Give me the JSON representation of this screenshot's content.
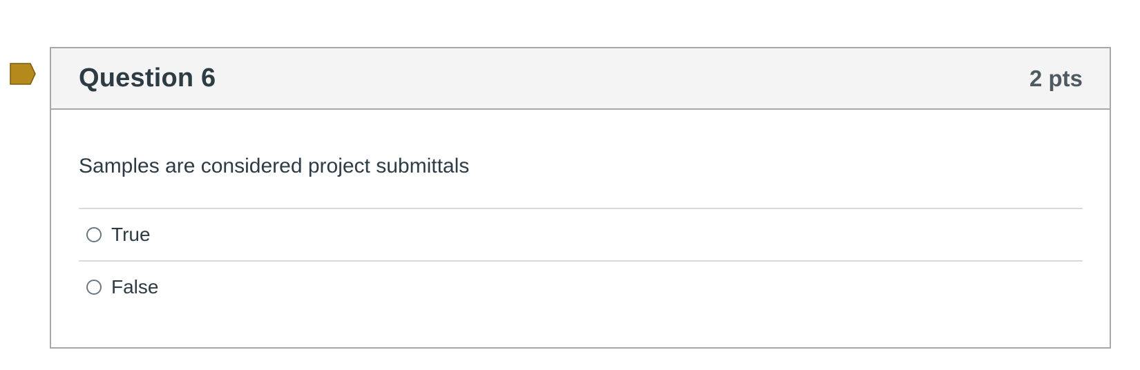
{
  "question": {
    "title": "Question 6",
    "points": "2 pts",
    "text": "Samples are considered project submittals",
    "flag_color": "#b5891b",
    "answers": [
      {
        "label": "True"
      },
      {
        "label": "False"
      }
    ]
  }
}
